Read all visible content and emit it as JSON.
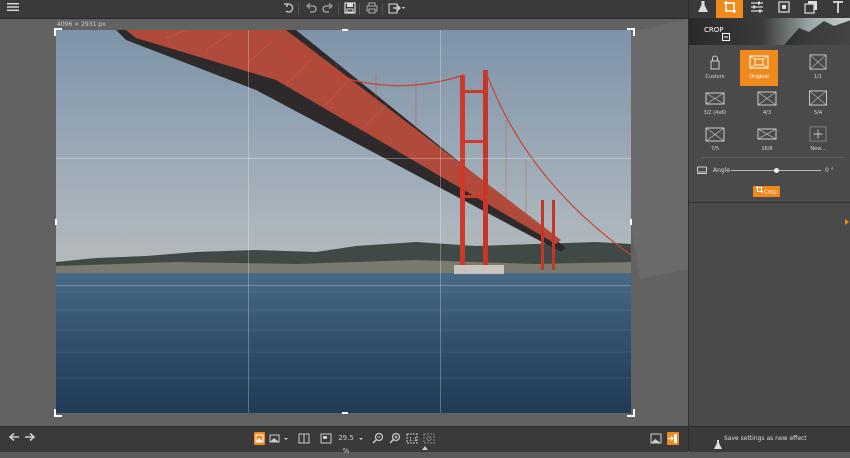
{
  "toolbar": {
    "menu_icon": "hamburger-menu-icon",
    "icons": [
      "undo-all-icon",
      "undo-icon",
      "redo-icon",
      "save-icon",
      "print-icon",
      "share-icon"
    ]
  },
  "canvas": {
    "image_dimensions": "4096 × 2931 px"
  },
  "panel": {
    "tabs": [
      "effects-flask-icon",
      "crop-icon",
      "adjust-sliders-icon",
      "transform-icon",
      "layers-icon",
      "text-icon"
    ],
    "section_title": "CROP",
    "presets": [
      {
        "label": "Custom"
      },
      {
        "label": "Original"
      },
      {
        "label": "1/1"
      },
      {
        "label": "3/2 (4x6)"
      },
      {
        "label": "4/3"
      },
      {
        "label": "5/4"
      },
      {
        "label": "7/5"
      },
      {
        "label": "16/9"
      },
      {
        "label": "New..."
      }
    ],
    "angle_label": "Angle",
    "angle_value": "0 °",
    "angle_fraction": 0.5,
    "crop_button": "Crop",
    "save_effect": "Save settings as new effect"
  },
  "bottom": {
    "zoom": "29.5 %"
  },
  "colors": {
    "accent": "#f08a1c",
    "panel_bg": "#4a4a4a",
    "toolbar_bg": "#3a3a3a",
    "canvas_bg": "#626262"
  }
}
